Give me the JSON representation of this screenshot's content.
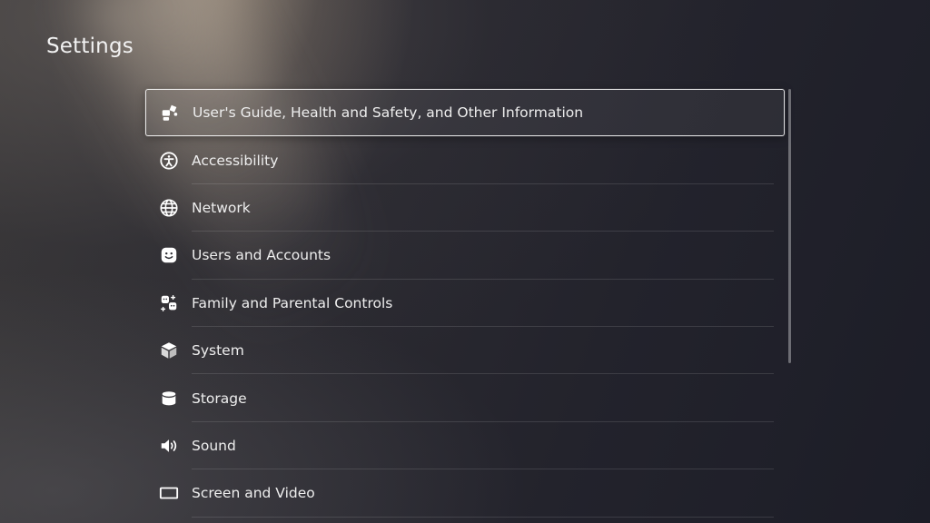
{
  "header": {
    "title": "Settings"
  },
  "menu": {
    "items": [
      {
        "label": "User's Guide, Health and Safety, and Other Information",
        "icon": "guide-icon",
        "selected": true
      },
      {
        "label": "Accessibility",
        "icon": "accessibility-icon",
        "selected": false
      },
      {
        "label": "Network",
        "icon": "globe-icon",
        "selected": false
      },
      {
        "label": "Users and Accounts",
        "icon": "user-face-icon",
        "selected": false
      },
      {
        "label": "Family and Parental Controls",
        "icon": "family-icon",
        "selected": false
      },
      {
        "label": "System",
        "icon": "cube-icon",
        "selected": false
      },
      {
        "label": "Storage",
        "icon": "storage-icon",
        "selected": false
      },
      {
        "label": "Sound",
        "icon": "speaker-icon",
        "selected": false
      },
      {
        "label": "Screen and Video",
        "icon": "screen-icon",
        "selected": false
      }
    ]
  },
  "colors": {
    "text": "#ffffff",
    "selection_border": "#ffffff",
    "divider": "#3a3a44"
  }
}
